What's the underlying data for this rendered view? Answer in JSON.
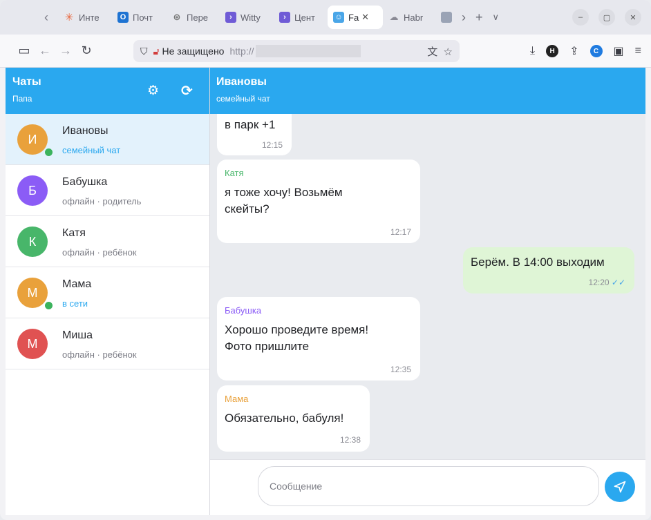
{
  "browser": {
    "tabs": [
      {
        "label": "Инте",
        "icon": "asterisk-icon",
        "color": "#e8663d"
      },
      {
        "label": "Почт",
        "icon": "outlook-icon",
        "color": "#1e73d2"
      },
      {
        "label": "Пере",
        "icon": "translate-icon",
        "color": "#777777"
      },
      {
        "label": "Witty",
        "icon": "arrow-icon",
        "color": "#6f5bd6"
      },
      {
        "label": "Цент",
        "icon": "arrow-icon",
        "color": "#6f5bd6"
      },
      {
        "label": "Fa",
        "icon": "family-icon",
        "color": "#4aa6e8"
      },
      {
        "label": "Habr",
        "icon": "cloud-icon",
        "color": "#8a8a95"
      }
    ],
    "address": {
      "security": "Не защищено",
      "url_prefix": "http://"
    }
  },
  "sidebar": {
    "title": "Чаты",
    "subtitle": "Папа",
    "chats": [
      {
        "name": "Ивановы",
        "initial": "И",
        "sub": "семейный чат",
        "color": "#e9a13b",
        "online": true
      },
      {
        "name": "Бабушка",
        "initial": "Б",
        "sub": "офлайн · родитель",
        "color": "#8b5cf6",
        "online": false
      },
      {
        "name": "Катя",
        "initial": "К",
        "sub": "офлайн · ребёнок",
        "color": "#48b66a",
        "online": false
      },
      {
        "name": "Мама",
        "initial": "М",
        "sub": "в сети",
        "color": "#e9a13b",
        "online": true
      },
      {
        "name": "Миша",
        "initial": "М",
        "sub": "офлайн · ребёнок",
        "color": "#e05252",
        "online": false
      }
    ]
  },
  "chat": {
    "title": "Ивановы",
    "subtitle": "семейный чат",
    "messages": [
      {
        "author": "",
        "author_color": "",
        "text": "в парк +1",
        "time": "12:15",
        "outgoing": false
      },
      {
        "author": "Катя",
        "author_color": "#48b66a",
        "text": "я тоже хочу! Возьмём скейты?",
        "time": "12:17",
        "outgoing": false
      },
      {
        "author": "",
        "author_color": "",
        "text": "Берём. В 14:00 выходим",
        "time": "12:20",
        "outgoing": true
      },
      {
        "author": "Бабушка",
        "author_color": "#8b5cf6",
        "text": "Хорошо проведите время! Фото пришлите",
        "time": "12:35",
        "outgoing": false
      },
      {
        "author": "Мама",
        "author_color": "#e9a13b",
        "text": "Обязательно, бабуля!",
        "time": "12:38",
        "outgoing": false
      }
    ],
    "composer_placeholder": "Сообщение"
  },
  "colors": {
    "accent": "#2aa8ef",
    "outgoing_bubble": "#dff5d6",
    "online": "#3cb35d"
  }
}
